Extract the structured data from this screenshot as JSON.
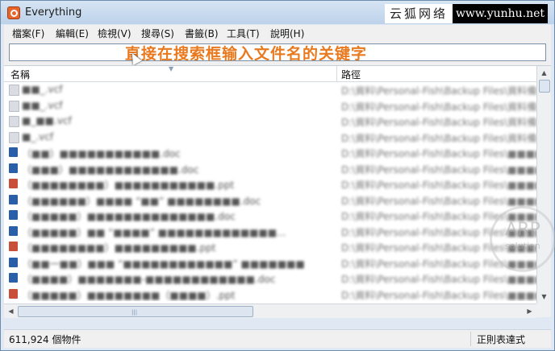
{
  "window": {
    "title": "Everything"
  },
  "watermark": {
    "site_name": "云狐网络",
    "url": "www.yunhu.net",
    "badge_top": "ARP",
    "badge_bottom": "solution"
  },
  "menu": [
    "檔案(F)",
    "編輯(E)",
    "檢視(V)",
    "搜尋(S)",
    "書籤(B)",
    "工具(T)",
    "說明(H)"
  ],
  "search": {
    "value": "",
    "hint": "直接在搜索框输入文件名的关键字"
  },
  "columns": {
    "name": "名稱",
    "path": "路徑"
  },
  "rows": [
    {
      "icon": "vcf-file-icon",
      "name": "■■_.vcf",
      "path": "D:\\資料\\Personal-Fish\\Backup Files\\資料備份"
    },
    {
      "icon": "vcf-file-icon",
      "name": "■■_.vcf",
      "path": "D:\\資料\\Personal-Fish\\Backup Files\\資料備份"
    },
    {
      "icon": "vcf-file-icon",
      "name": "■_■■.vcf",
      "path": "D:\\資料\\Personal-Fish\\Backup Files\\資料備份"
    },
    {
      "icon": "vcf-file-icon",
      "name": "■_.vcf",
      "path": "D:\\資料\\Personal-Fish\\Backup Files\\資料備份"
    },
    {
      "icon": "doc-file-icon",
      "name": "（■■）■■■■■■■■■■■.doc",
      "path": "D:\\資料\\Personal-Fish\\Backup Files\\■■■■"
    },
    {
      "icon": "doc-file-icon",
      "name": "（■■■）■■■■■■■■■■■■.doc",
      "path": "D:\\資料\\Personal-Fish\\Backup Files\\■■■■"
    },
    {
      "icon": "ppt-file-icon",
      "name": "（■■■■■■■■）■■■■■■■■■■■.ppt",
      "path": "D:\\資料\\Personal-Fish\\Backup Files\\■■■■"
    },
    {
      "icon": "doc-file-icon",
      "name": "（■■■■■■）■■■■ “■■” ■■■■■■■■.doc",
      "path": "D:\\資料\\Personal-Fish\\Backup Files\\■■■■"
    },
    {
      "icon": "doc-file-icon",
      "name": "（■■■■■）■■■■■■■■■■■■■■.doc",
      "path": "D:\\資料\\Personal-Fish\\Backup Files\\■■■■"
    },
    {
      "icon": "doc-file-icon",
      "name": "（■■■■■）■■ “■■■■” ■■■■■■■■■■■■■...",
      "path": "D:\\資料\\Personal-Fish\\Backup Files\\■■■■"
    },
    {
      "icon": "ppt-file-icon",
      "name": "（■■■■■■■■）■■■■■■■■■.ppt",
      "path": "D:\\資料\\Personal-Fish\\Backup Files\\■■■■"
    },
    {
      "icon": "doc-file-icon",
      "name": "（■■一■■）■■■ “■■■■■■■■■■■■” ■■■■■■■",
      "path": "D:\\資料\\Personal-Fish\\Backup Files\\■■■■"
    },
    {
      "icon": "doc-file-icon",
      "name": "（■■■■）■■■■■■■-■■■■■■■■■■■■.doc",
      "path": "D:\\資料\\Personal-Fish\\Backup Files\\■■■■"
    },
    {
      "icon": "ppt-file-icon",
      "name": "（■■■■■）■■■■■■■■（■■■■）.ppt",
      "path": "D:\\資料\\Personal-Fish\\Backup Files\\■■■■"
    }
  ],
  "status": {
    "count": "611,924 個物件",
    "mode": "正則表達式"
  }
}
